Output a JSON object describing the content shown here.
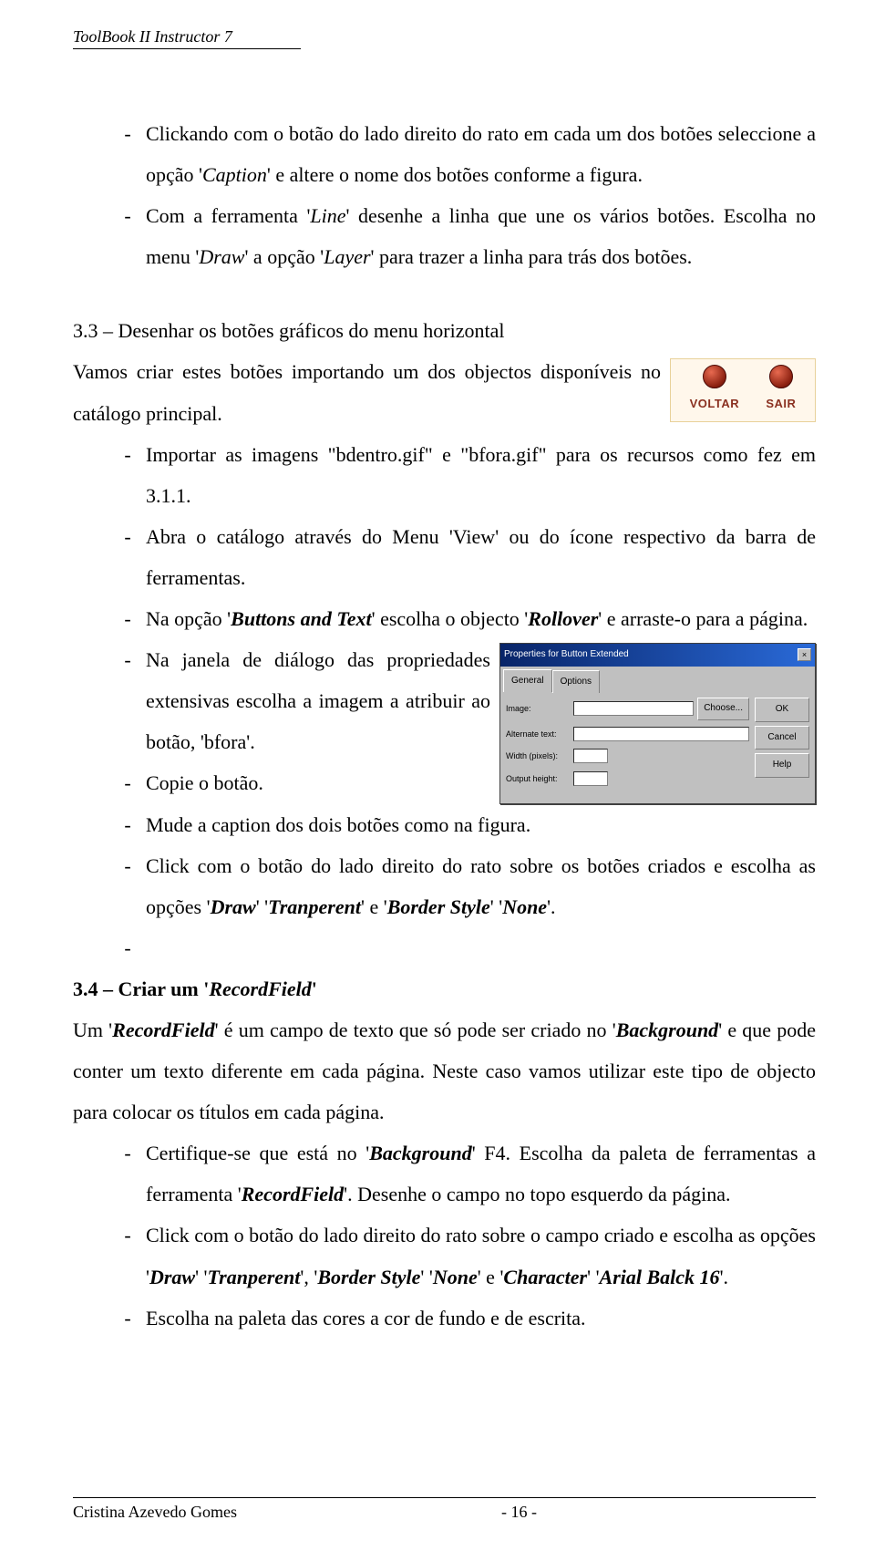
{
  "header": {
    "title": "ToolBook II Instructor 7"
  },
  "voltar_sair": {
    "l": "VOLTAR",
    "r": "SAIR"
  },
  "dlg": {
    "title": "Properties for Button Extended",
    "tabs": {
      "general": "General",
      "options": "Options"
    },
    "lbl_image": "Image:",
    "lbl_choose": "Choose...",
    "lbl_alt": "Alternate text:",
    "lbl_wid": "Width (pixels):",
    "lbl_hei": "Output height:",
    "btn_ok": "OK",
    "btn_cancel": "Cancel",
    "btn_help": "Help"
  },
  "dash": "-",
  "para1": {
    "a": "Clickando com o botão do lado direito do rato em cada um dos botões seleccione a opção '",
    "b": "Caption",
    "c": "' e altere o nome dos botões conforme a figura."
  },
  "para2": {
    "a": "Com a ferramenta '",
    "b": "Line",
    "c": "' desenhe a linha que une os vários botões. Escolha no menu '",
    "d": "Draw",
    "e": "' a opção '",
    "f": "Layer",
    "g": "' para trazer a linha para trás dos botões."
  },
  "sec33": {
    "title": "3.3 – Desenhar os botões gráficos do menu horizontal",
    "p1": "Vamos criar estes botões importando um dos objectos disponíveis no catálogo principal.",
    "b1": "Importar as imagens \"bdentro.gif\" e \"bfora.gif\" para os recursos como fez em 3.1.1.",
    "b2": "Abra o catálogo através do Menu 'View' ou do ícone respectivo da barra de ferramentas.",
    "b3a": "Na opção '",
    "b3b": "Buttons and Text",
    "b3c": "' escolha o objecto '",
    "b3d": "Rollover",
    "b3e": "' e arraste-o para a página.",
    "b4": "Na janela de diálogo das propriedades extensivas escolha a imagem a atribuir ao botão, 'bfora'.",
    "b5": "Copie o botão.",
    "b6": "Mude a caption dos dois botões como na figura.",
    "b7a": "Click com o botão do lado direito do rato sobre os botões criados e escolha as opções '",
    "b7b": "Draw",
    "b7c": "' '",
    "b7d": "Tranperent",
    "b7e": "' e '",
    "b7f": "Border Style",
    "b7g": "' '",
    "b7h": "None",
    "b7i": "'."
  },
  "sec34": {
    "title_a": "3.4 – Criar um '",
    "title_b": "RecordField",
    "title_c": "'",
    "p1a": "Um '",
    "p1b": "RecordField",
    "p1c": "' é um campo de texto que só pode ser criado no '",
    "p1d": "Background",
    "p1e": "' e que pode conter um texto diferente em cada página. Neste caso vamos utilizar este tipo de objecto para colocar os títulos em cada página.",
    "b1a": "Certifique-se que está no '",
    "b1b": "Background",
    "b1c": "' F4. Escolha da paleta de ferramentas a ferramenta '",
    "b1d": "RecordField",
    "b1e": "'. Desenhe o campo no topo esquerdo da página.",
    "b2a": "Click com o botão do lado direito do rato sobre o campo criado e escolha as opções '",
    "b2b": "Draw",
    "b2c": "' '",
    "b2d": "Tranperent",
    "b2e": "', '",
    "b2f": "Border Style",
    "b2g": "' '",
    "b2h": "None",
    "b2i": "' e '",
    "b2j": "Character",
    "b2k": "' '",
    "b2l": "Arial Balck 16",
    "b2m": "'.",
    "b3": "Escolha na paleta das cores a cor de fundo e de escrita."
  },
  "footer": {
    "author": "Cristina Azevedo Gomes",
    "page": "- 16 -"
  }
}
